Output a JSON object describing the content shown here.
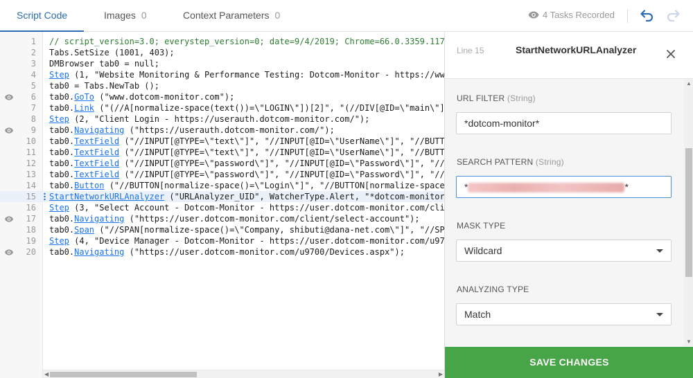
{
  "tabs": [
    {
      "label": "Script Code",
      "count": ""
    },
    {
      "label": "Images",
      "count": "0"
    },
    {
      "label": "Context Parameters",
      "count": "0"
    }
  ],
  "header": {
    "tasks_recorded": "4 Tasks Recorded"
  },
  "editor": {
    "line_numbers": [
      "1",
      "2",
      "3",
      "4",
      "5",
      "6",
      "7",
      "8",
      "9",
      "10",
      "11",
      "12",
      "13",
      "14",
      "15",
      "16",
      "17",
      "18",
      "19",
      "20"
    ],
    "lines": [
      [
        {
          "t": "// script_version=3.0; everystep_version=0; date=9/4/2019; Chrome=66.0.3359.117",
          "c": "cm"
        }
      ],
      [
        {
          "t": "Tabs.SetSize (1001, 403);",
          "c": ""
        }
      ],
      [
        {
          "t": "DMBrowser tab0 = null;",
          "c": ""
        }
      ],
      [
        {
          "t": "Step",
          "c": "kw"
        },
        {
          "t": " (1, \"Website Monitoring & Performance Testing: Dotcom-Monitor - https://www.",
          "c": "str"
        }
      ],
      [
        {
          "t": "tab0 = Tabs.NewTab ();",
          "c": ""
        }
      ],
      [
        {
          "t": "tab0.",
          "c": ""
        },
        {
          "t": "GoTo",
          "c": "kw"
        },
        {
          "t": " (\"www.dotcom-monitor.com\");",
          "c": "str"
        }
      ],
      [
        {
          "t": "tab0.",
          "c": ""
        },
        {
          "t": "Link",
          "c": "kw"
        },
        {
          "t": " (\"(//A[normalize-space(text())=\\\"LOGIN\\\"])[2]\", \"(//DIV[@ID=\\\"main\\\"]/",
          "c": "str"
        }
      ],
      [
        {
          "t": "Step",
          "c": "kw"
        },
        {
          "t": " (2, \"Client Login - https://userauth.dotcom-monitor.com/\");",
          "c": "str"
        }
      ],
      [
        {
          "t": "tab0.",
          "c": ""
        },
        {
          "t": "Navigating",
          "c": "kw"
        },
        {
          "t": " (\"https://userauth.dotcom-monitor.com/\");",
          "c": "str"
        }
      ],
      [
        {
          "t": "tab0.",
          "c": ""
        },
        {
          "t": "TextField",
          "c": "kw"
        },
        {
          "t": " (\"//INPUT[@TYPE=\\\"text\\\"]\", \"//INPUT[@ID=\\\"UserName\\\"]\", \"//BUTTO",
          "c": "str"
        }
      ],
      [
        {
          "t": "tab0.",
          "c": ""
        },
        {
          "t": "TextField",
          "c": "kw"
        },
        {
          "t": " (\"//INPUT[@TYPE=\\\"text\\\"]\", \"//INPUT[@ID=\\\"UserName\\\"]\", \"//BUTTO",
          "c": "str"
        }
      ],
      [
        {
          "t": "tab0.",
          "c": ""
        },
        {
          "t": "TextField",
          "c": "kw"
        },
        {
          "t": " (\"//INPUT[@TYPE=\\\"password\\\"]\", \"//INPUT[@ID=\\\"Password\\\"]\", \"//B",
          "c": "str"
        }
      ],
      [
        {
          "t": "tab0.",
          "c": ""
        },
        {
          "t": "TextField",
          "c": "kw"
        },
        {
          "t": " (\"//INPUT[@TYPE=\\\"password\\\"]\", \"//INPUT[@ID=\\\"Password\\\"]\", \"//B",
          "c": "str"
        }
      ],
      [
        {
          "t": "tab0.",
          "c": ""
        },
        {
          "t": "Button",
          "c": "kw"
        },
        {
          "t": " (\"//BUTTON[normalize-space()=\\\"Login\\\"]\", \"//BUTTON[normalize-space(",
          "c": "str"
        }
      ],
      [
        {
          "t": "StartNetworkURLAnalyzer",
          "c": "kw"
        },
        {
          "t": " (\"URLAnalyzer_UID\", WatcherType.Alert, \"*dotcom-monitor*\"",
          "c": "str"
        }
      ],
      [
        {
          "t": "Step",
          "c": "kw"
        },
        {
          "t": " (3, \"Select Account - Dotcom-Monitor - https://user.dotcom-monitor.com/clie",
          "c": "str"
        }
      ],
      [
        {
          "t": "tab0.",
          "c": ""
        },
        {
          "t": "Navigating",
          "c": "kw"
        },
        {
          "t": " (\"https://user.dotcom-monitor.com/client/select-account\");",
          "c": "str"
        }
      ],
      [
        {
          "t": "tab0.",
          "c": ""
        },
        {
          "t": "Span",
          "c": "kw"
        },
        {
          "t": " (\"//SPAN[normalize-space()=\\\"Company, shibuti@dana-net.com\\\"]\", \"//SPA",
          "c": "str"
        }
      ],
      [
        {
          "t": "Step",
          "c": "kw"
        },
        {
          "t": " (4, \"Device Manager - Dotcom-Monitor - https://user.dotcom-monitor.com/u970",
          "c": "str"
        }
      ],
      [
        {
          "t": "tab0.",
          "c": ""
        },
        {
          "t": "Navigating",
          "c": "kw"
        },
        {
          "t": " (\"https://user.dotcom-monitor.com/u9700/Devices.aspx\");",
          "c": "str"
        }
      ]
    ],
    "eye_lines": [
      6,
      9,
      17,
      20
    ],
    "highlight_line": 15
  },
  "panel": {
    "line_label": "Line 15",
    "title": "StartNetworkURLAnalyzer",
    "url_filter": {
      "label": "URL FILTER",
      "type": "(String)",
      "value": "*dotcom-monitor*"
    },
    "search_pattern": {
      "label": "SEARCH PATTERN",
      "type": "(String)",
      "prefix": "*",
      "suffix": "*"
    },
    "mask_type": {
      "label": "MASK TYPE",
      "value": "Wildcard"
    },
    "analyzing_type": {
      "label": "ANALYZING TYPE",
      "value": "Match"
    },
    "save_label": "SAVE CHANGES"
  },
  "colors": {
    "accent": "#2b6cb5",
    "save": "#47a447",
    "comment": "#2e7d32",
    "keyword": "#1a73e8",
    "highlight": "#eaf1f9"
  }
}
